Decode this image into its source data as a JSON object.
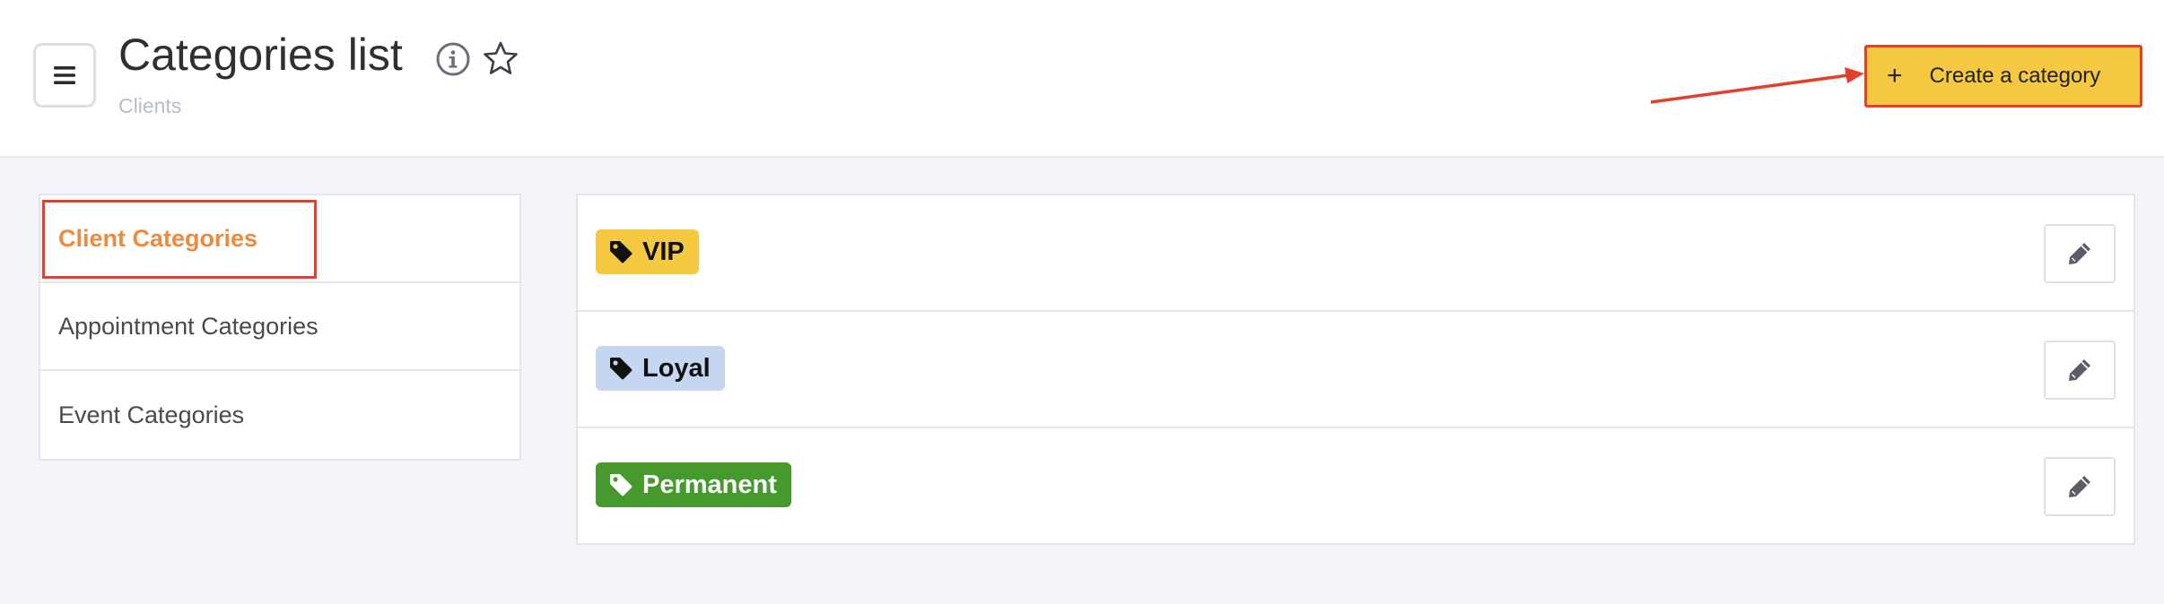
{
  "header": {
    "title": "Categories list",
    "subtitle": "Clients",
    "create_button_label": "Create a category",
    "create_button_icon": "plus-icon"
  },
  "sidebar": {
    "items": [
      {
        "label": "Client Categories",
        "active": true
      },
      {
        "label": "Appointment Categories",
        "active": false
      },
      {
        "label": "Event Categories",
        "active": false
      }
    ]
  },
  "categories": [
    {
      "name": "VIP",
      "bg": "#f5c842",
      "fg": "#111111",
      "icon": "tag-icon"
    },
    {
      "name": "Loyal",
      "bg": "#c5d7f0",
      "fg": "#111111",
      "icon": "tag-icon"
    },
    {
      "name": "Permanent",
      "bg": "#45992d",
      "fg": "#ffffff",
      "icon": "tag-icon"
    }
  ],
  "colors": {
    "accent": "#f5c842",
    "active_nav": "#ee8a3c",
    "annotation": "#e2402c"
  }
}
